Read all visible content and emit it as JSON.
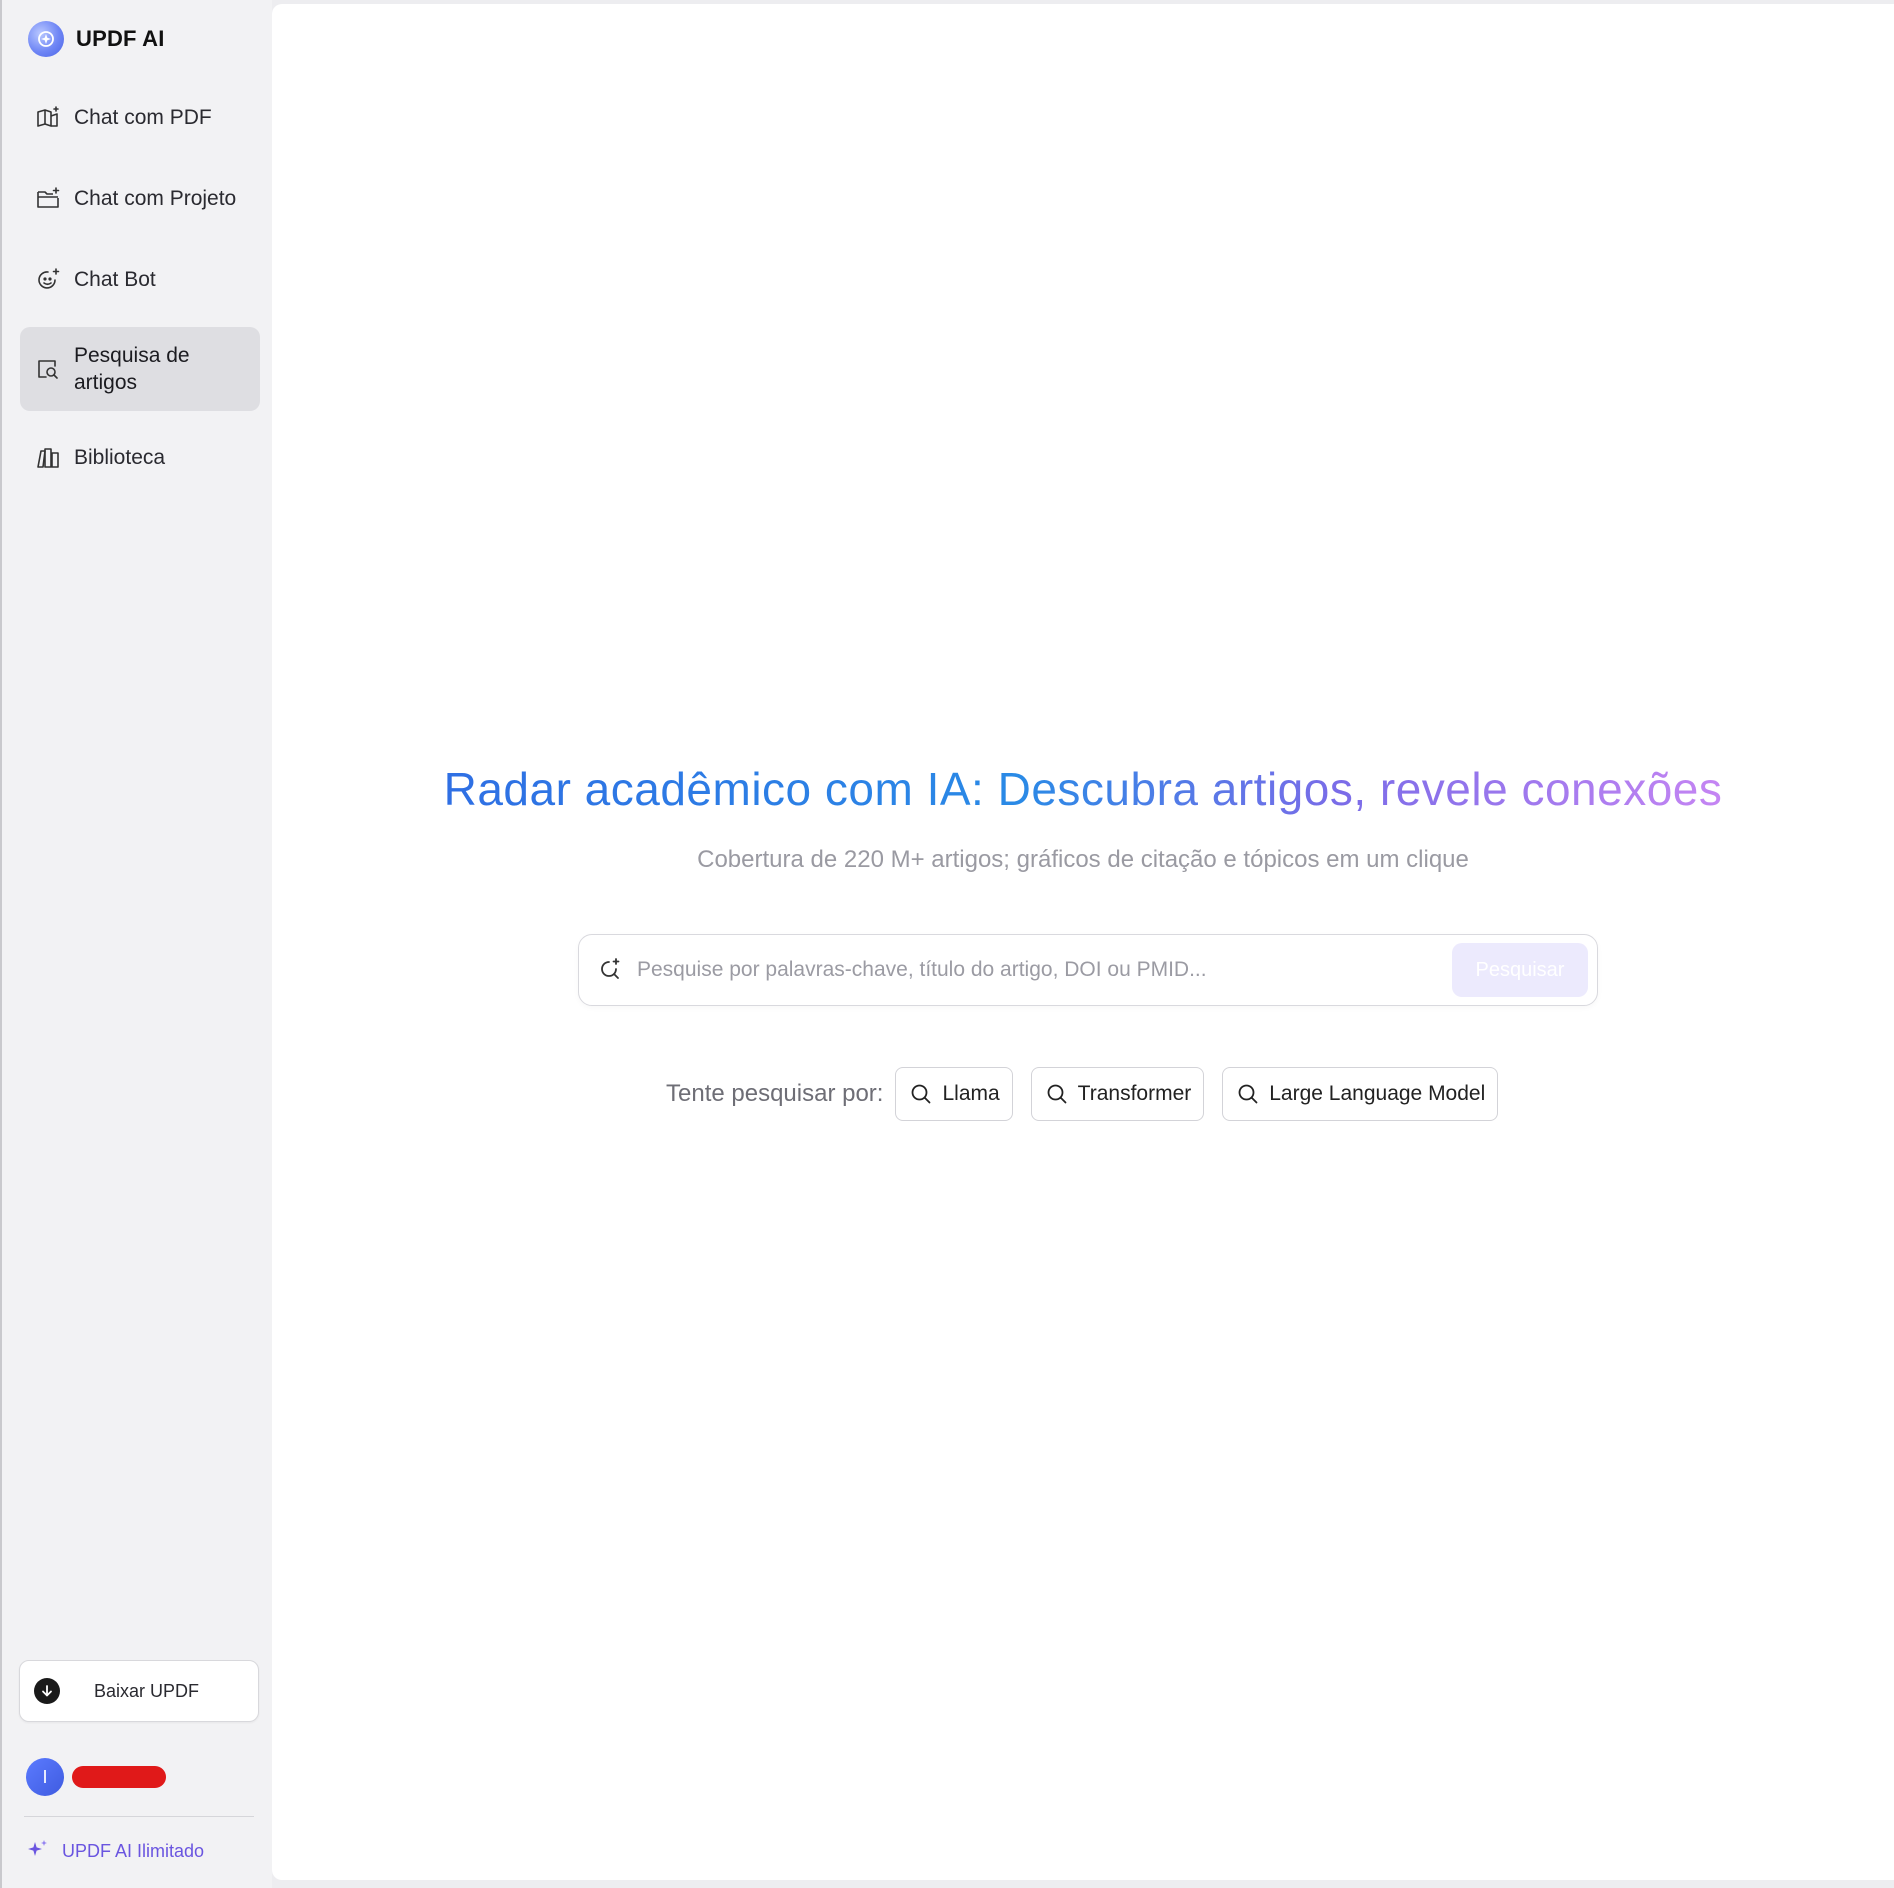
{
  "app": {
    "brand_title": "UPDF AI"
  },
  "sidebar": {
    "items": [
      {
        "label": "Chat com PDF",
        "icon": "book-sparkle-icon"
      },
      {
        "label": "Chat com Projeto",
        "icon": "folder-sparkle-icon"
      },
      {
        "label": "Chat Bot",
        "icon": "bot-face-icon"
      },
      {
        "label": "Pesquisa de artigos",
        "icon": "document-search-icon",
        "active": true
      },
      {
        "label": "Biblioteca",
        "icon": "library-books-icon"
      }
    ],
    "download_label": "Baixar UPDF",
    "user": {
      "avatar_initial": "I",
      "name": ""
    },
    "plan_label": "UPDF AI Ilimitado"
  },
  "main": {
    "title": "Radar acadêmico com IA: Descubra artigos, revele conexões",
    "subtitle": "Cobertura de 220 M+ artigos; gráficos de citação e tópicos em um clique",
    "search": {
      "placeholder": "Pesquise por palavras-chave, título do artigo, DOI ou PMID...",
      "value": "",
      "button_label": "Pesquisar"
    },
    "suggestions": {
      "label": "Tente pesquisar por:",
      "chips": [
        "Llama",
        "Transformer",
        "Large Language Model"
      ]
    }
  },
  "colors": {
    "accent_blue": "#2f6fe4",
    "accent_purple": "#c585f3",
    "plan_purple": "#6a55e0",
    "redaction": "#e01919"
  }
}
